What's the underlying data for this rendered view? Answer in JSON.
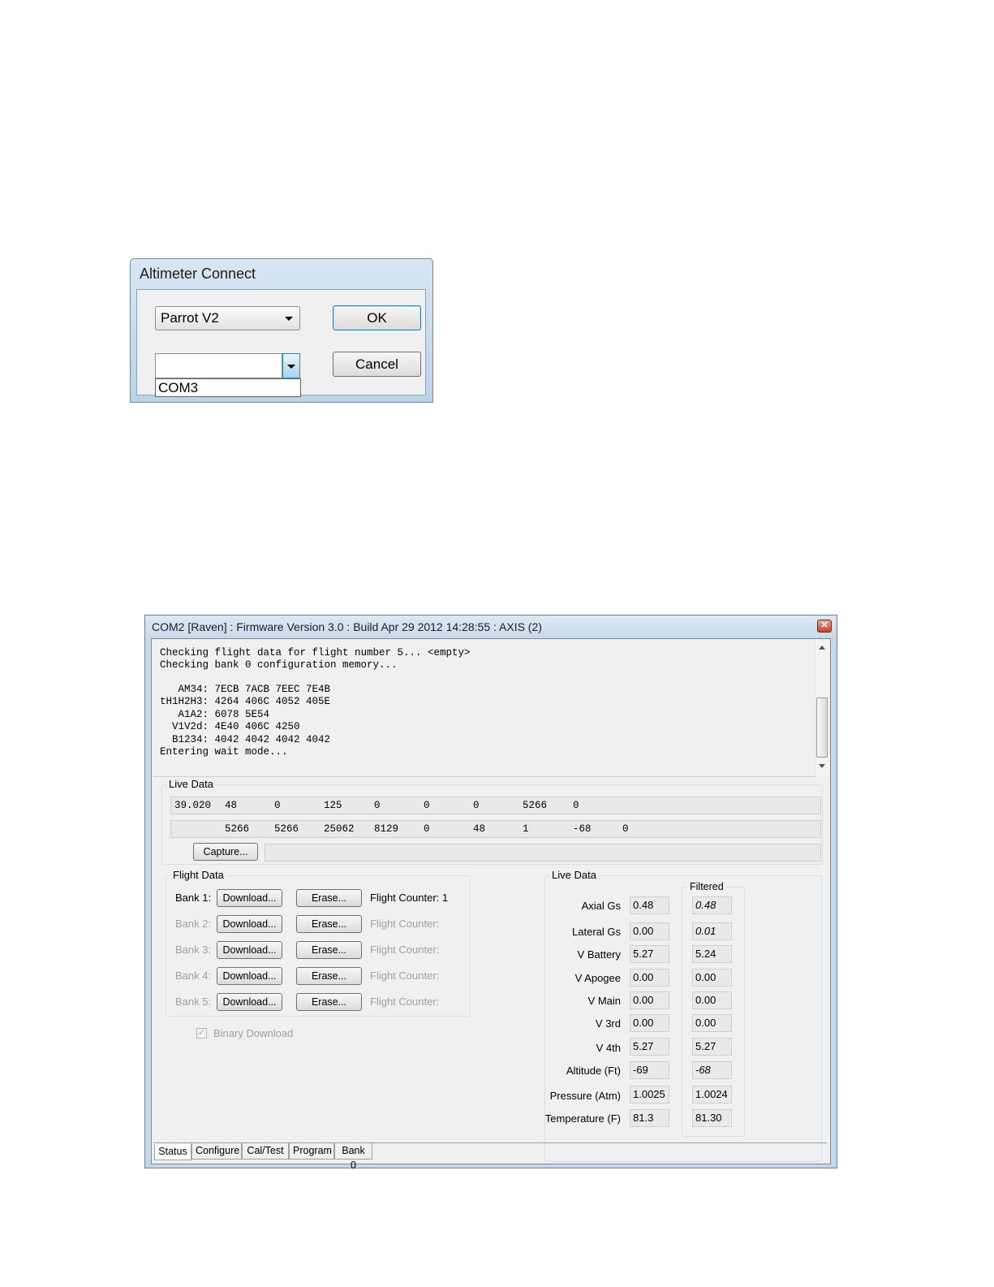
{
  "connect_dialog": {
    "title": "Altimeter Connect",
    "device_select": "Parrot V2",
    "port_value": "",
    "port_options": [
      "COM3"
    ],
    "ok_label": "OK",
    "cancel_label": "Cancel"
  },
  "main_window": {
    "title": "COM2 [Raven] : Firmware Version 3.0 : Build Apr 29 2012 14:28:55 : AXIS (2)",
    "close_icon": "close-icon",
    "console_lines": [
      "Checking flight data for flight number 5... <empty>",
      "Checking bank 0 configuration memory...",
      "",
      "   AM34: 7ECB 7ACB 7EEC 7E4B",
      "tH1H2H3: 4264 406C 4052 405E",
      "   A1A2: 6078 5E54",
      "  V1V2d: 4E40 406C 4250",
      "  B1234: 4042 4042 4042 4042",
      "Entering wait mode..."
    ],
    "live_data_top": {
      "label": "Live Data",
      "row1": [
        "39.020",
        "48",
        "0",
        "125",
        "0",
        "0",
        "0",
        "5266",
        "0"
      ],
      "row2": [
        "5266",
        "5266",
        "25062",
        "8129",
        "0",
        "48",
        "1",
        "-68",
        "0"
      ],
      "capture_label": "Capture..."
    },
    "flight_data": {
      "label": "Flight Data",
      "download_label": "Download...",
      "erase_label": "Erase...",
      "banks": [
        {
          "name": "Bank 1:",
          "counter": "Flight Counter: 1",
          "enabled": true
        },
        {
          "name": "Bank 2:",
          "counter": "Flight Counter:",
          "enabled": false
        },
        {
          "name": "Bank 3:",
          "counter": "Flight Counter:",
          "enabled": false
        },
        {
          "name": "Bank 4:",
          "counter": "Flight Counter:",
          "enabled": false
        },
        {
          "name": "Bank 5:",
          "counter": "Flight Counter:",
          "enabled": false
        }
      ],
      "binary_download_label": "Binary Download",
      "binary_download_checked": true
    },
    "live_data_panel": {
      "label": "Live Data",
      "filtered_label": "Filtered",
      "rows": [
        {
          "label": "Axial Gs",
          "raw": "0.48",
          "filtered": "0.48"
        },
        {
          "label": "Lateral Gs",
          "raw": "0.00",
          "filtered": "0.01"
        },
        {
          "label": "V Battery",
          "raw": "5.27",
          "filtered": "5.24"
        },
        {
          "label": "V Apogee",
          "raw": "0.00",
          "filtered": "0.00"
        },
        {
          "label": "V Main",
          "raw": "0.00",
          "filtered": "0.00"
        },
        {
          "label": "V 3rd",
          "raw": "0.00",
          "filtered": "0.00"
        },
        {
          "label": "V 4th",
          "raw": "5.27",
          "filtered": "5.27"
        },
        {
          "label": "Altitude (Ft)",
          "raw": "-69",
          "filtered": "-68"
        },
        {
          "label": "Pressure (Atm)",
          "raw": "1.0025",
          "filtered": "1.0024"
        },
        {
          "label": "Temperature (F)",
          "raw": "81.3",
          "filtered": "81.30"
        }
      ]
    },
    "tabs": [
      "Status",
      "Configure",
      "Cal/Test",
      "Program",
      "Bank 0"
    ],
    "active_tab": "Status"
  }
}
